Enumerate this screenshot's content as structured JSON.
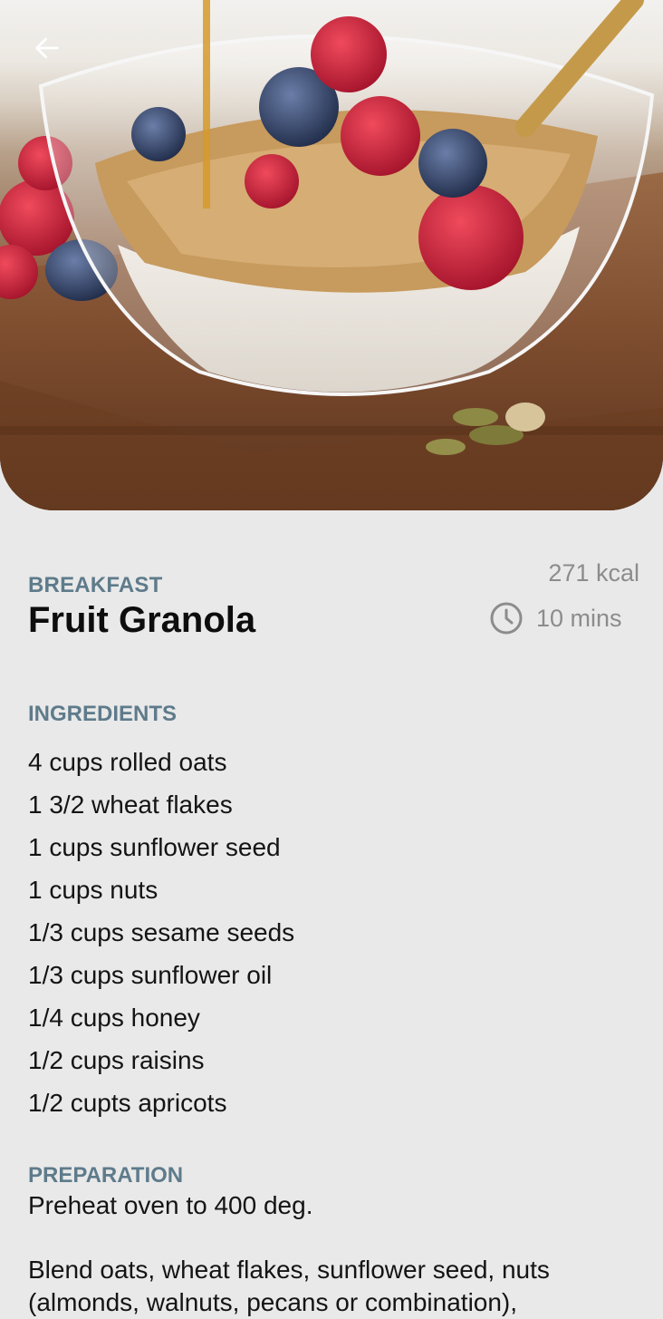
{
  "recipe": {
    "category": "BREAKFAST",
    "title": "Fruit Granola",
    "calories": "271 kcal",
    "time": "10 mins"
  },
  "ingredients": {
    "heading": "INGREDIENTS",
    "items": [
      "4 cups rolled oats",
      "1 3/2 wheat flakes",
      "1 cups sunflower seed",
      "1 cups nuts",
      "1/3 cups sesame seeds",
      "1/3 cups sunflower oil",
      "1/4 cups honey",
      "1/2 cups raisins",
      "1/2 cupts apricots"
    ]
  },
  "preparation": {
    "heading": "PREPARATION",
    "steps": [
      "Preheat oven to 400 deg.",
      "Blend oats, wheat flakes, sunflower seed, nuts (almonds, walnuts, pecans or combination),"
    ]
  },
  "icons": {
    "back": "arrow-left-icon",
    "clock": "clock-icon"
  },
  "colors": {
    "background": "#e9e9e9",
    "section_label": "#5e7b8b",
    "meta_text": "#8c8c8c",
    "title_text": "#0d0d0d"
  }
}
